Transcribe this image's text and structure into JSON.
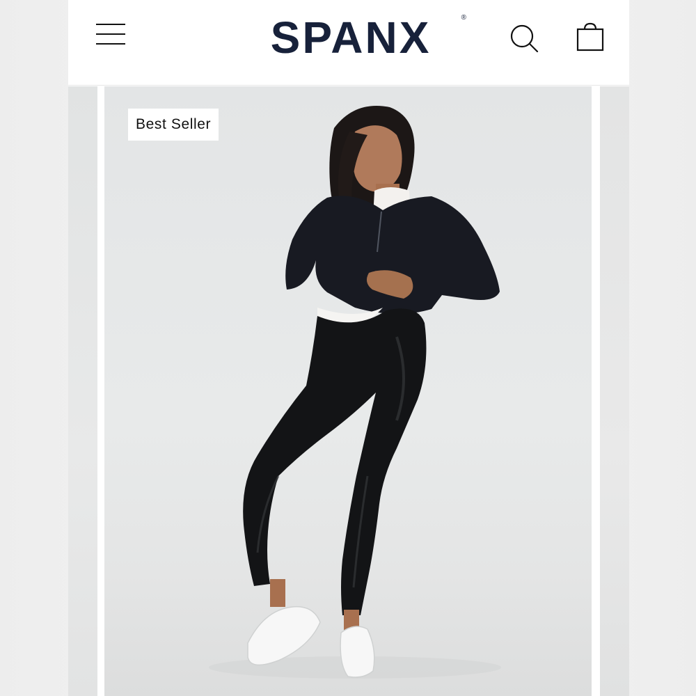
{
  "header": {
    "brand": "SPANX",
    "brand_mark": "®",
    "menu_icon": "hamburger-menu-icon",
    "search_icon": "search-icon",
    "bag_icon": "shopping-bag-icon"
  },
  "product": {
    "badge": "Best Seller",
    "image_description": "model wearing black faux leather leggings"
  },
  "colors": {
    "brand": "#17213a",
    "background": "#ffffff",
    "photo_backdrop": "#e6e8e8"
  }
}
